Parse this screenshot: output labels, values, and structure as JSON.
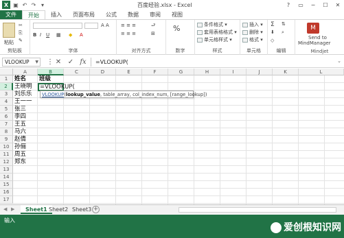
{
  "window": {
    "title": "百度经验.xlsx - Excel",
    "app_logo": "X",
    "accent": "#217346"
  },
  "quick_access": [
    "save-icon",
    "undo-icon",
    "redo-icon",
    "customize-icon"
  ],
  "window_buttons": [
    "?",
    "▭",
    "─",
    "☐",
    "✕"
  ],
  "tabs": [
    {
      "label": "文件"
    },
    {
      "label": "开始"
    },
    {
      "label": "插入"
    },
    {
      "label": "页面布局"
    },
    {
      "label": "公式"
    },
    {
      "label": "数据"
    },
    {
      "label": "审阅"
    },
    {
      "label": "视图"
    }
  ],
  "ribbon": {
    "clipboard": {
      "label": "剪贴板",
      "paste": "粘贴"
    },
    "font": {
      "label": "字体"
    },
    "alignment": {
      "label": "对齐方式"
    },
    "number": {
      "label": "数字"
    },
    "styles": {
      "label": "样式",
      "items": [
        "条件格式 ▾",
        "套用表格格式 ▾",
        "单元格样式 ▾"
      ]
    },
    "cells": {
      "label": "单元格",
      "items": [
        "插入 ▾",
        "删除 ▾",
        "格式 ▾"
      ]
    },
    "editing": {
      "label": "编辑"
    },
    "mindjet": {
      "label": "Mindjet",
      "button_line1": "Send to",
      "button_line2": "MindManager"
    }
  },
  "formula_bar": {
    "name_box": "VLOOKUP",
    "cancel": "✕",
    "enter": "✓",
    "fx": "fx",
    "content": "=VLOOKUP("
  },
  "columns": [
    "A",
    "B",
    "C",
    "D",
    "E",
    "F",
    "G",
    "H",
    "I",
    "J",
    "K",
    "L"
  ],
  "rows": [
    "1",
    "2",
    "3",
    "4",
    "5",
    "6",
    "7",
    "8",
    "9",
    "10",
    "11",
    "12",
    "13",
    "14",
    "15",
    "16",
    "17"
  ],
  "cells": {
    "A1": "姓名",
    "B1": "班级",
    "A2": "王晓明",
    "A3": "刘乐乐",
    "A4": "王一一",
    "A5": "张三",
    "A6": "李四",
    "A7": "王五",
    "A8": "马六",
    "A9": "赵倩",
    "A10": "孙俪",
    "A11": "周五",
    "A12": "郑东",
    "B2": "=VLOOKUP("
  },
  "tooltip": {
    "fn": "VLOOKUP",
    "open": "(",
    "arg1": "lookup_value",
    "rest": ", table_array, col_index_num, [range_lookup])"
  },
  "sheets": {
    "tabs": [
      "Sheet1",
      "Sheet2",
      "Sheet3"
    ],
    "active": "Sheet1",
    "add": "+"
  },
  "status": {
    "mode": "输入",
    "watermark": "爱创根知识网"
  }
}
